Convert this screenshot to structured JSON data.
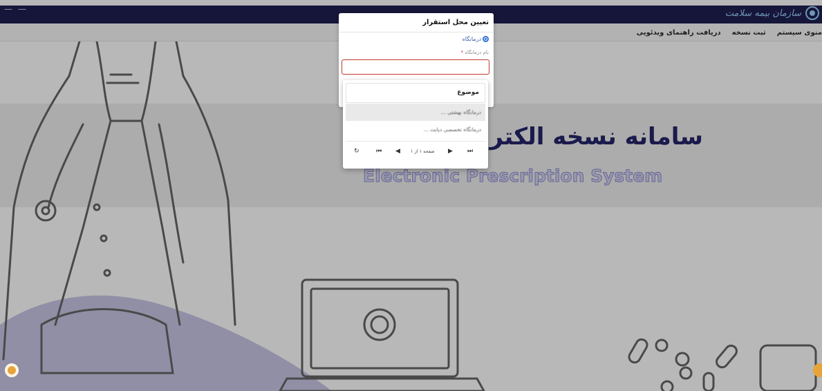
{
  "header": {
    "brand_name": "سازمان بیمه سلامت",
    "left_fragment": "— —"
  },
  "nav": {
    "items": [
      "منوی سیستم",
      "ثبت نسخه",
      "دریافت راهنمای ویدئویی"
    ]
  },
  "hero": {
    "title_fa": "سامانه نسخه الکترو",
    "title_en": "Electronic Prescription System"
  },
  "modal": {
    "title": "تعیین محل استقرار",
    "radio_label": "درمانگاه",
    "field_label": "نام درمانگاه",
    "required_mark": "*",
    "field_value": ""
  },
  "dropdown": {
    "header": "موضوع",
    "items": [
      "درمانگاه بهشتی ...",
      "درمانگاه تخصصی دیابت ..."
    ],
    "pager": {
      "refresh_icon": "refresh-icon",
      "first_icon": "first-page-icon",
      "prev_icon": "prev-page-icon",
      "next_icon": "next-page-icon",
      "last_icon": "last-page-icon",
      "page_text": "صفحه ۱ از ۱"
    }
  },
  "colors": {
    "topbar": "#1e1f4f",
    "title": "#25256a",
    "accent": "#2f6fd6",
    "error_border": "#c0392b"
  }
}
